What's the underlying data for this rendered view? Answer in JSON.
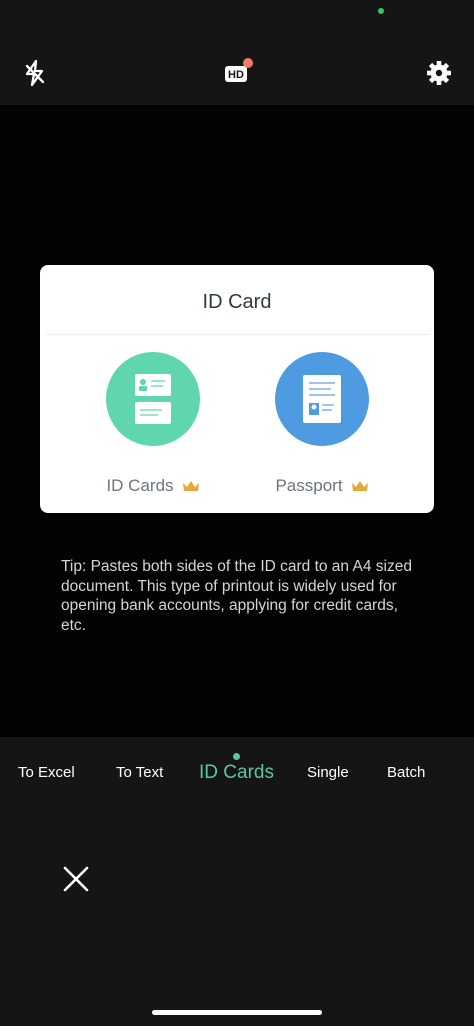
{
  "top_bar": {
    "flash_icon": "flash-off-icon",
    "hd_icon": "hd-icon",
    "settings_icon": "gear-icon",
    "accent": "#ef7a66"
  },
  "card": {
    "title": "ID Card",
    "options": [
      {
        "label": "ID Cards",
        "icon": "id-card-icon",
        "color": "#5fd6ad",
        "badge_icon": "crown-icon"
      },
      {
        "label": "Passport",
        "icon": "passport-icon",
        "color": "#4f9be2",
        "badge_icon": "crown-icon"
      }
    ]
  },
  "tip": "Tip: Pastes both sides of the ID card to an A4 sized document. This type of printout is widely used for opening bank accounts, applying for credit cards, etc.",
  "modes": {
    "items": [
      "To Excel",
      "To Text",
      "ID Cards",
      "Single",
      "Batch"
    ],
    "selected": "ID Cards",
    "accent": "#5cc6a2"
  },
  "close_icon": "close-icon"
}
